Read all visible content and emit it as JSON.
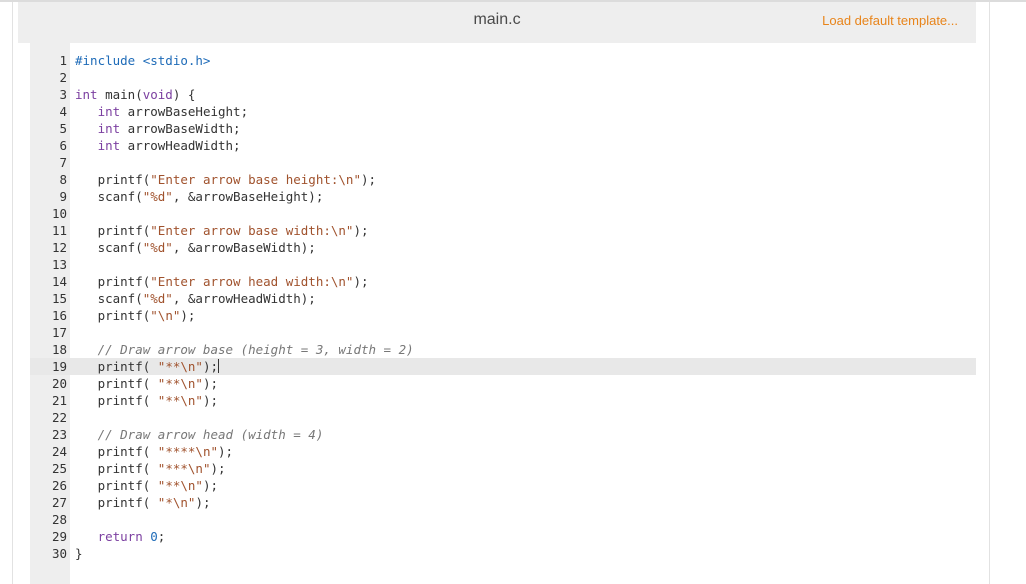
{
  "header": {
    "filename": "main.c",
    "load_template_label": "Load default template..."
  },
  "editor": {
    "active_line": 19,
    "lines": [
      {
        "n": "1",
        "tokens": [
          {
            "t": "#include <stdio.h>",
            "c": "pre"
          }
        ]
      },
      {
        "n": "2",
        "tokens": []
      },
      {
        "n": "3",
        "tokens": [
          {
            "t": "int",
            "c": "kw"
          },
          {
            "t": " main(",
            "c": "plain"
          },
          {
            "t": "void",
            "c": "kw"
          },
          {
            "t": ") {",
            "c": "plain"
          }
        ]
      },
      {
        "n": "4",
        "tokens": [
          {
            "t": "   ",
            "c": "plain"
          },
          {
            "t": "int",
            "c": "kw"
          },
          {
            "t": " arrowBaseHeight;",
            "c": "plain"
          }
        ]
      },
      {
        "n": "5",
        "tokens": [
          {
            "t": "   ",
            "c": "plain"
          },
          {
            "t": "int",
            "c": "kw"
          },
          {
            "t": " arrowBaseWidth;",
            "c": "plain"
          }
        ]
      },
      {
        "n": "6",
        "tokens": [
          {
            "t": "   ",
            "c": "plain"
          },
          {
            "t": "int",
            "c": "kw"
          },
          {
            "t": " arrowHeadWidth;",
            "c": "plain"
          }
        ]
      },
      {
        "n": "7",
        "tokens": []
      },
      {
        "n": "8",
        "tokens": [
          {
            "t": "   printf(",
            "c": "plain"
          },
          {
            "t": "\"Enter arrow base height:\\n\"",
            "c": "str"
          },
          {
            "t": ");",
            "c": "plain"
          }
        ]
      },
      {
        "n": "9",
        "tokens": [
          {
            "t": "   scanf(",
            "c": "plain"
          },
          {
            "t": "\"%d\"",
            "c": "str"
          },
          {
            "t": ", &arrowBaseHeight);",
            "c": "plain"
          }
        ]
      },
      {
        "n": "10",
        "tokens": []
      },
      {
        "n": "11",
        "tokens": [
          {
            "t": "   printf(",
            "c": "plain"
          },
          {
            "t": "\"Enter arrow base width:\\n\"",
            "c": "str"
          },
          {
            "t": ");",
            "c": "plain"
          }
        ]
      },
      {
        "n": "12",
        "tokens": [
          {
            "t": "   scanf(",
            "c": "plain"
          },
          {
            "t": "\"%d\"",
            "c": "str"
          },
          {
            "t": ", &arrowBaseWidth);",
            "c": "plain"
          }
        ]
      },
      {
        "n": "13",
        "tokens": []
      },
      {
        "n": "14",
        "tokens": [
          {
            "t": "   printf(",
            "c": "plain"
          },
          {
            "t": "\"Enter arrow head width:\\n\"",
            "c": "str"
          },
          {
            "t": ");",
            "c": "plain"
          }
        ]
      },
      {
        "n": "15",
        "tokens": [
          {
            "t": "   scanf(",
            "c": "plain"
          },
          {
            "t": "\"%d\"",
            "c": "str"
          },
          {
            "t": ", &arrowHeadWidth);",
            "c": "plain"
          }
        ]
      },
      {
        "n": "16",
        "tokens": [
          {
            "t": "   printf(",
            "c": "plain"
          },
          {
            "t": "\"\\n\"",
            "c": "str"
          },
          {
            "t": ");",
            "c": "plain"
          }
        ]
      },
      {
        "n": "17",
        "tokens": []
      },
      {
        "n": "18",
        "tokens": [
          {
            "t": "   ",
            "c": "plain"
          },
          {
            "t": "// Draw arrow base (height = 3, width = 2)",
            "c": "com"
          }
        ]
      },
      {
        "n": "19",
        "tokens": [
          {
            "t": "   printf( ",
            "c": "plain"
          },
          {
            "t": "\"**\\n\"",
            "c": "str"
          },
          {
            "t": ");",
            "c": "plain"
          }
        ]
      },
      {
        "n": "20",
        "tokens": [
          {
            "t": "   printf( ",
            "c": "plain"
          },
          {
            "t": "\"**\\n\"",
            "c": "str"
          },
          {
            "t": ");",
            "c": "plain"
          }
        ]
      },
      {
        "n": "21",
        "tokens": [
          {
            "t": "   printf( ",
            "c": "plain"
          },
          {
            "t": "\"**\\n\"",
            "c": "str"
          },
          {
            "t": ");",
            "c": "plain"
          }
        ]
      },
      {
        "n": "22",
        "tokens": []
      },
      {
        "n": "23",
        "tokens": [
          {
            "t": "   ",
            "c": "plain"
          },
          {
            "t": "// Draw arrow head (width = 4)",
            "c": "com"
          }
        ]
      },
      {
        "n": "24",
        "tokens": [
          {
            "t": "   printf( ",
            "c": "plain"
          },
          {
            "t": "\"****\\n\"",
            "c": "str"
          },
          {
            "t": ");",
            "c": "plain"
          }
        ]
      },
      {
        "n": "25",
        "tokens": [
          {
            "t": "   printf( ",
            "c": "plain"
          },
          {
            "t": "\"***\\n\"",
            "c": "str"
          },
          {
            "t": ");",
            "c": "plain"
          }
        ]
      },
      {
        "n": "26",
        "tokens": [
          {
            "t": "   printf( ",
            "c": "plain"
          },
          {
            "t": "\"**\\n\"",
            "c": "str"
          },
          {
            "t": ");",
            "c": "plain"
          }
        ]
      },
      {
        "n": "27",
        "tokens": [
          {
            "t": "   printf( ",
            "c": "plain"
          },
          {
            "t": "\"*\\n\"",
            "c": "str"
          },
          {
            "t": ");",
            "c": "plain"
          }
        ]
      },
      {
        "n": "28",
        "tokens": []
      },
      {
        "n": "29",
        "tokens": [
          {
            "t": "   ",
            "c": "plain"
          },
          {
            "t": "return",
            "c": "kw"
          },
          {
            "t": " ",
            "c": "plain"
          },
          {
            "t": "0",
            "c": "num"
          },
          {
            "t": ";",
            "c": "plain"
          }
        ]
      },
      {
        "n": "30",
        "tokens": [
          {
            "t": "}",
            "c": "plain"
          }
        ]
      }
    ]
  },
  "colors": {
    "accent_link": "#e8841a",
    "header_bg": "#eeeeee",
    "active_line_bg": "#e8e8e8"
  }
}
